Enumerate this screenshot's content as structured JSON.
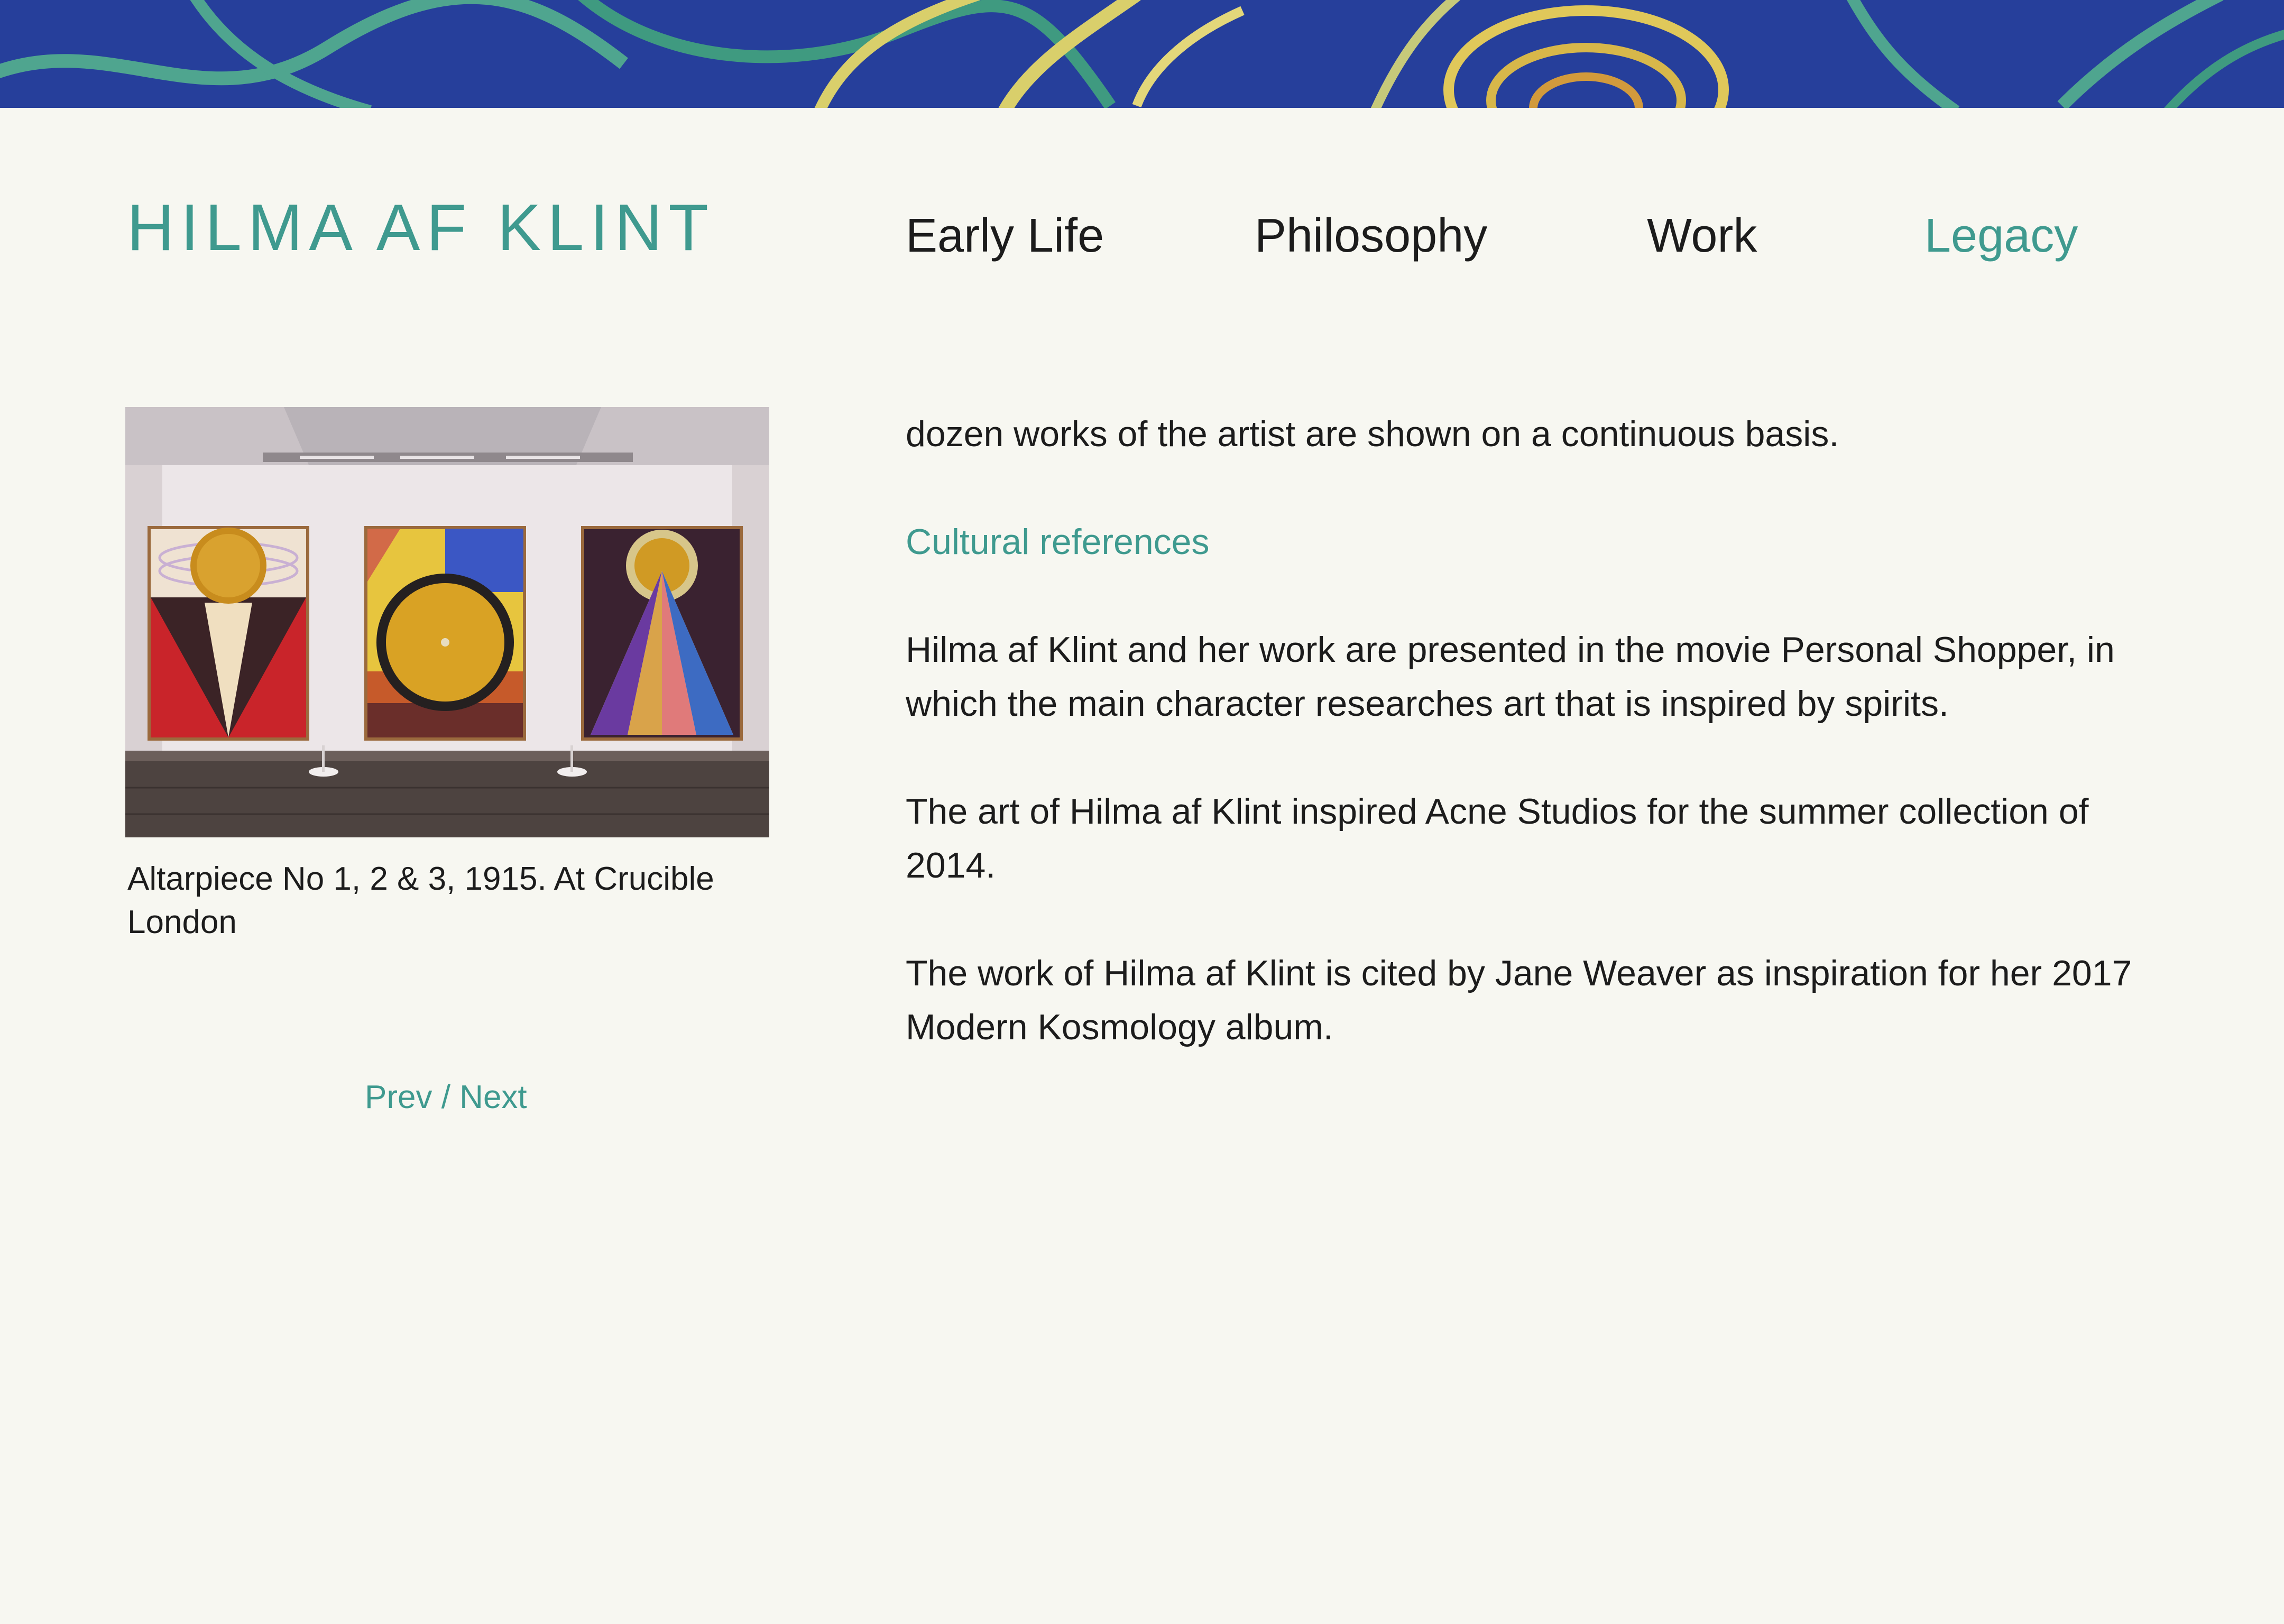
{
  "brand": {
    "title": "HILMA AF KLINT"
  },
  "nav": {
    "items": [
      {
        "label": "Early Life"
      },
      {
        "label": "Philosophy"
      },
      {
        "label": "Work"
      },
      {
        "label": "Legacy",
        "active": true
      }
    ]
  },
  "gallery": {
    "caption": "Altarpiece No 1, 2 & 3, 1915. At Crucible London",
    "prev_label": "Prev",
    "separator": " / ",
    "next_label": "Next"
  },
  "article": {
    "intro": "dozen works of the artist are shown on a continuous basis.",
    "section_heading": "Cultural references",
    "paragraphs": [
      "Hilma af Klint and her work are presented in the movie Personal Shopper, in which the main character researches art that is inspired by spirits.",
      "The art of Hilma af Klint inspired Acne Studios for the summer collection of 2014.",
      "The work of Hilma af Klint is cited by Jane Weaver as inspiration for her 2017 Modern Kosmology album."
    ]
  },
  "colors": {
    "accent": "#3f9a8f",
    "background": "#f7f7f1",
    "text": "#1c1c1c",
    "banner_blue": "#2b46a3"
  }
}
